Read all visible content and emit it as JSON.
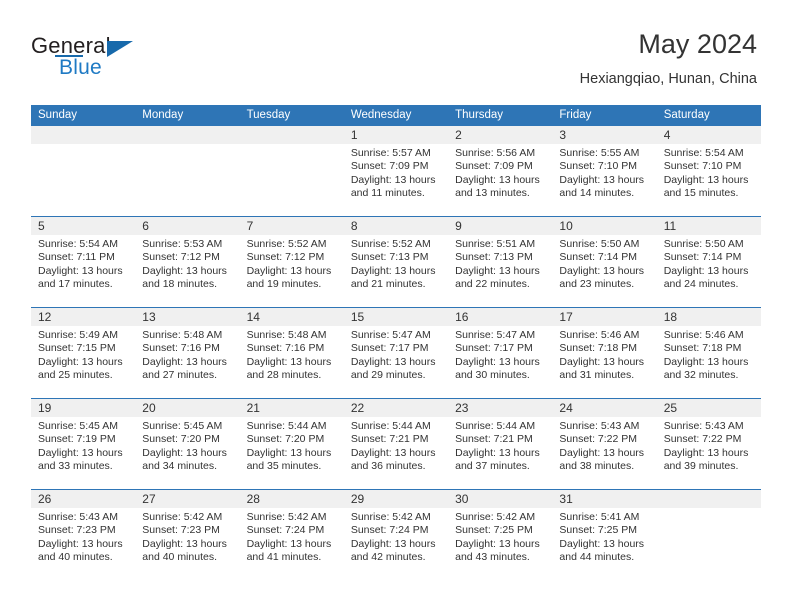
{
  "brand": {
    "name_top": "General",
    "name_bottom": "Blue"
  },
  "header": {
    "title": "May 2024",
    "subtitle": "Hexiangqiao, Hunan, China"
  },
  "colors": {
    "header_blue": "#2e75b6",
    "brand_blue": "#1f7ac4",
    "day_band": "#f0f0f0",
    "text": "#333333"
  },
  "weekdays": [
    "Sunday",
    "Monday",
    "Tuesday",
    "Wednesday",
    "Thursday",
    "Friday",
    "Saturday"
  ],
  "weeks": [
    {
      "days": [
        {
          "num": "",
          "lines": []
        },
        {
          "num": "",
          "lines": []
        },
        {
          "num": "",
          "lines": []
        },
        {
          "num": "1",
          "lines": [
            "Sunrise: 5:57 AM",
            "Sunset: 7:09 PM",
            "Daylight: 13 hours",
            "and 11 minutes."
          ]
        },
        {
          "num": "2",
          "lines": [
            "Sunrise: 5:56 AM",
            "Sunset: 7:09 PM",
            "Daylight: 13 hours",
            "and 13 minutes."
          ]
        },
        {
          "num": "3",
          "lines": [
            "Sunrise: 5:55 AM",
            "Sunset: 7:10 PM",
            "Daylight: 13 hours",
            "and 14 minutes."
          ]
        },
        {
          "num": "4",
          "lines": [
            "Sunrise: 5:54 AM",
            "Sunset: 7:10 PM",
            "Daylight: 13 hours",
            "and 15 minutes."
          ]
        }
      ]
    },
    {
      "days": [
        {
          "num": "5",
          "lines": [
            "Sunrise: 5:54 AM",
            "Sunset: 7:11 PM",
            "Daylight: 13 hours",
            "and 17 minutes."
          ]
        },
        {
          "num": "6",
          "lines": [
            "Sunrise: 5:53 AM",
            "Sunset: 7:12 PM",
            "Daylight: 13 hours",
            "and 18 minutes."
          ]
        },
        {
          "num": "7",
          "lines": [
            "Sunrise: 5:52 AM",
            "Sunset: 7:12 PM",
            "Daylight: 13 hours",
            "and 19 minutes."
          ]
        },
        {
          "num": "8",
          "lines": [
            "Sunrise: 5:52 AM",
            "Sunset: 7:13 PM",
            "Daylight: 13 hours",
            "and 21 minutes."
          ]
        },
        {
          "num": "9",
          "lines": [
            "Sunrise: 5:51 AM",
            "Sunset: 7:13 PM",
            "Daylight: 13 hours",
            "and 22 minutes."
          ]
        },
        {
          "num": "10",
          "lines": [
            "Sunrise: 5:50 AM",
            "Sunset: 7:14 PM",
            "Daylight: 13 hours",
            "and 23 minutes."
          ]
        },
        {
          "num": "11",
          "lines": [
            "Sunrise: 5:50 AM",
            "Sunset: 7:14 PM",
            "Daylight: 13 hours",
            "and 24 minutes."
          ]
        }
      ]
    },
    {
      "days": [
        {
          "num": "12",
          "lines": [
            "Sunrise: 5:49 AM",
            "Sunset: 7:15 PM",
            "Daylight: 13 hours",
            "and 25 minutes."
          ]
        },
        {
          "num": "13",
          "lines": [
            "Sunrise: 5:48 AM",
            "Sunset: 7:16 PM",
            "Daylight: 13 hours",
            "and 27 minutes."
          ]
        },
        {
          "num": "14",
          "lines": [
            "Sunrise: 5:48 AM",
            "Sunset: 7:16 PM",
            "Daylight: 13 hours",
            "and 28 minutes."
          ]
        },
        {
          "num": "15",
          "lines": [
            "Sunrise: 5:47 AM",
            "Sunset: 7:17 PM",
            "Daylight: 13 hours",
            "and 29 minutes."
          ]
        },
        {
          "num": "16",
          "lines": [
            "Sunrise: 5:47 AM",
            "Sunset: 7:17 PM",
            "Daylight: 13 hours",
            "and 30 minutes."
          ]
        },
        {
          "num": "17",
          "lines": [
            "Sunrise: 5:46 AM",
            "Sunset: 7:18 PM",
            "Daylight: 13 hours",
            "and 31 minutes."
          ]
        },
        {
          "num": "18",
          "lines": [
            "Sunrise: 5:46 AM",
            "Sunset: 7:18 PM",
            "Daylight: 13 hours",
            "and 32 minutes."
          ]
        }
      ]
    },
    {
      "days": [
        {
          "num": "19",
          "lines": [
            "Sunrise: 5:45 AM",
            "Sunset: 7:19 PM",
            "Daylight: 13 hours",
            "and 33 minutes."
          ]
        },
        {
          "num": "20",
          "lines": [
            "Sunrise: 5:45 AM",
            "Sunset: 7:20 PM",
            "Daylight: 13 hours",
            "and 34 minutes."
          ]
        },
        {
          "num": "21",
          "lines": [
            "Sunrise: 5:44 AM",
            "Sunset: 7:20 PM",
            "Daylight: 13 hours",
            "and 35 minutes."
          ]
        },
        {
          "num": "22",
          "lines": [
            "Sunrise: 5:44 AM",
            "Sunset: 7:21 PM",
            "Daylight: 13 hours",
            "and 36 minutes."
          ]
        },
        {
          "num": "23",
          "lines": [
            "Sunrise: 5:44 AM",
            "Sunset: 7:21 PM",
            "Daylight: 13 hours",
            "and 37 minutes."
          ]
        },
        {
          "num": "24",
          "lines": [
            "Sunrise: 5:43 AM",
            "Sunset: 7:22 PM",
            "Daylight: 13 hours",
            "and 38 minutes."
          ]
        },
        {
          "num": "25",
          "lines": [
            "Sunrise: 5:43 AM",
            "Sunset: 7:22 PM",
            "Daylight: 13 hours",
            "and 39 minutes."
          ]
        }
      ]
    },
    {
      "days": [
        {
          "num": "26",
          "lines": [
            "Sunrise: 5:43 AM",
            "Sunset: 7:23 PM",
            "Daylight: 13 hours",
            "and 40 minutes."
          ]
        },
        {
          "num": "27",
          "lines": [
            "Sunrise: 5:42 AM",
            "Sunset: 7:23 PM",
            "Daylight: 13 hours",
            "and 40 minutes."
          ]
        },
        {
          "num": "28",
          "lines": [
            "Sunrise: 5:42 AM",
            "Sunset: 7:24 PM",
            "Daylight: 13 hours",
            "and 41 minutes."
          ]
        },
        {
          "num": "29",
          "lines": [
            "Sunrise: 5:42 AM",
            "Sunset: 7:24 PM",
            "Daylight: 13 hours",
            "and 42 minutes."
          ]
        },
        {
          "num": "30",
          "lines": [
            "Sunrise: 5:42 AM",
            "Sunset: 7:25 PM",
            "Daylight: 13 hours",
            "and 43 minutes."
          ]
        },
        {
          "num": "31",
          "lines": [
            "Sunrise: 5:41 AM",
            "Sunset: 7:25 PM",
            "Daylight: 13 hours",
            "and 44 minutes."
          ]
        },
        {
          "num": "",
          "lines": []
        }
      ]
    }
  ]
}
